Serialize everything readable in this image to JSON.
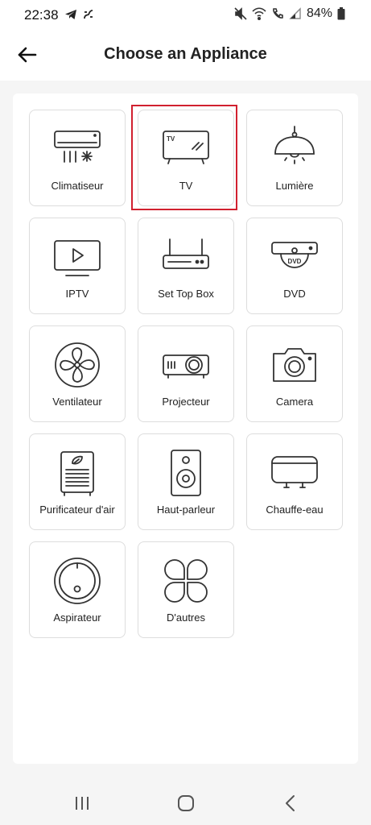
{
  "status_bar": {
    "time": "22:38",
    "battery": "84%",
    "left_icons": [
      "telegram-icon",
      "link-icon"
    ],
    "right_icons": [
      "mute-icon",
      "wifi-icon",
      "wifi-call-icon",
      "signal-icon",
      "battery-icon"
    ]
  },
  "header": {
    "title": "Choose an Appliance",
    "back_icon": "arrow-left-icon"
  },
  "appliances": [
    {
      "label": "Climatiseur",
      "icon": "air-conditioner-icon"
    },
    {
      "label": "TV",
      "icon": "tv-icon",
      "selected": true
    },
    {
      "label": "Lumière",
      "icon": "lamp-icon"
    },
    {
      "label": "IPTV",
      "icon": "iptv-icon"
    },
    {
      "label": "Set Top Box",
      "icon": "set-top-box-icon"
    },
    {
      "label": "DVD",
      "icon": "dvd-icon"
    },
    {
      "label": "Ventilateur",
      "icon": "fan-icon"
    },
    {
      "label": "Projecteur",
      "icon": "projector-icon"
    },
    {
      "label": "Camera",
      "icon": "camera-icon"
    },
    {
      "label": "Purificateur d'air",
      "icon": "air-purifier-icon"
    },
    {
      "label": "Haut-parleur",
      "icon": "speaker-icon"
    },
    {
      "label": "Chauffe-eau",
      "icon": "water-heater-icon"
    },
    {
      "label": "Aspirateur",
      "icon": "robot-vacuum-icon"
    },
    {
      "label": "D'autres",
      "icon": "others-icon"
    }
  ],
  "icon_inner_text": {
    "tv": "TV",
    "dvd": "DVD"
  },
  "nav_bar": {
    "icons": [
      "recent-apps-icon",
      "home-icon",
      "back-icon"
    ]
  },
  "colors": {
    "highlight": "#d1202f",
    "background": "#f5f5f5",
    "tile_border": "#dddddd"
  }
}
